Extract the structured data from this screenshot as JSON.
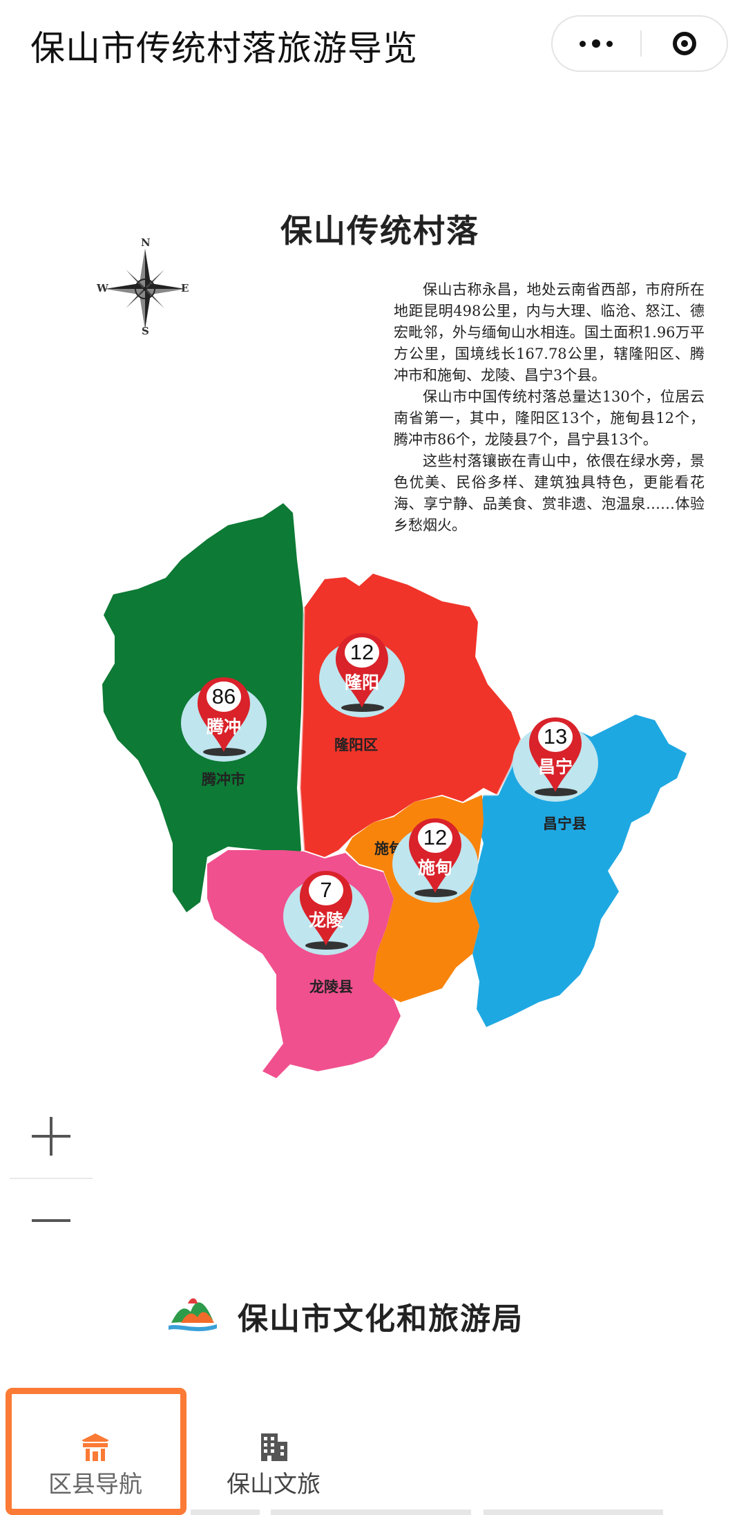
{
  "header": {
    "title": "保山市传统村落旅游导览",
    "more_icon": "more-dots-icon",
    "close_icon": "target-circle-icon"
  },
  "map": {
    "title": "保山传统村落",
    "compass": {
      "n": "N",
      "s": "S",
      "e": "E",
      "w": "W"
    },
    "intro": [
      "保山古称永昌，地处云南省西部，市府所在地距昆明498公里，内与大理、临沧、怒江、德宏毗邻，外与缅甸山水相连。国土面积1.96万平方公里，国境线长167.78公里，辖隆阳区、腾冲市和施甸、龙陵、昌宁3个县。",
      "保山市中国传统村落总量达130个，位居云南省第一，其中，隆阳区13个，施甸县12个，腾冲市86个，龙陵县7个，昌宁县13个。",
      "这些村落镶嵌在青山中，依偎在绿水旁，景色优美、民俗多样、建筑独具特色，更能看花海、享宁静、品美食、赏非遗、泡温泉……体验乡愁烟火。"
    ],
    "districts": {
      "tengchong": "腾冲市",
      "longyang": "隆阳区",
      "changning": "昌宁县",
      "shidian": "施甸",
      "longling": "龙陵县"
    },
    "markers": [
      {
        "name": "腾冲",
        "count": "86"
      },
      {
        "name": "隆阳",
        "count": "12"
      },
      {
        "name": "昌宁",
        "count": "13"
      },
      {
        "name": "施甸",
        "count": "12"
      },
      {
        "name": "龙陵",
        "count": "7"
      }
    ],
    "colors": {
      "tengchong": "#0d7a35",
      "longyang": "#f0342a",
      "changning": "#1ea8e2",
      "shidian": "#f8840c",
      "longling": "#f0508e",
      "pin": "#d9222a"
    }
  },
  "zoom": {
    "in_icon": "plus-icon",
    "out_icon": "minus-icon"
  },
  "footer": {
    "bureau": "保山市文化和旅游局"
  },
  "tabs": [
    {
      "label": "区县导航",
      "icon": "pavilion-icon",
      "active": true,
      "color": "#fb7a35"
    },
    {
      "label": "保山文旅",
      "icon": "building-icon",
      "active": false,
      "color": "#555555"
    }
  ]
}
